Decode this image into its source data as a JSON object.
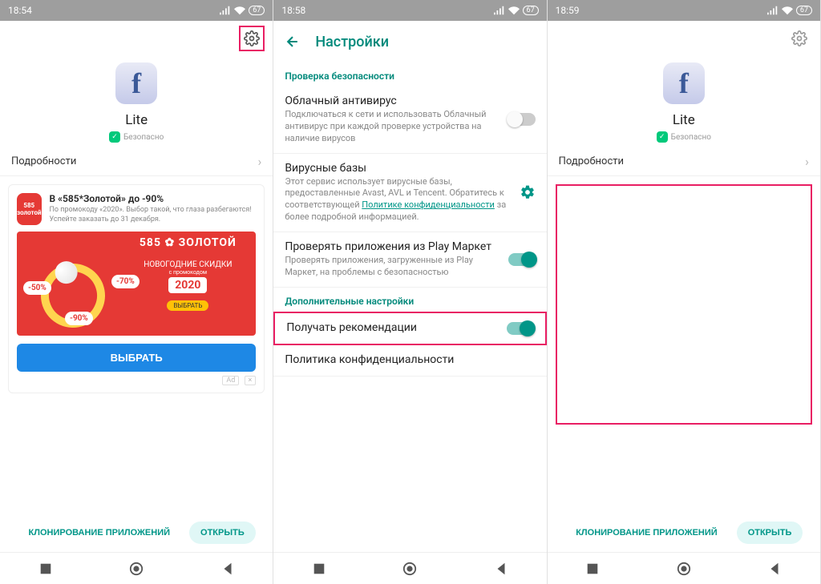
{
  "screen1": {
    "time": "18:54",
    "battery": "67",
    "app_name": "Lite",
    "safety_label": "Безопасно",
    "details_label": "Подробности",
    "ad": {
      "logo_top": "585",
      "logo_bottom": "золотой",
      "title": "В «585*Золотой» до -90%",
      "subtitle": "По промокоду «2020». Выбор такой, что глаза разбегаются! Успейте заказать до 31 декабря.",
      "banner_brand": "585 ✿ ЗОЛОТОЙ",
      "banner_headline": "НОВОГОДНИЕ СКИДКИ",
      "banner_promo_label": "с промокодом",
      "banner_promo_code": "2020",
      "discount1": "-50%",
      "discount2": "-70%",
      "discount3": "-90%",
      "banner_cta": "ВЫБРАТЬ",
      "select_button": "ВЫБРАТЬ",
      "ad_tag": "Ad",
      "ad_close": "×"
    },
    "bottom_clone": "КЛОНИРОВАНИЕ ПРИЛОЖЕНИЙ",
    "bottom_open": "ОТКРЫТЬ"
  },
  "screen2": {
    "time": "18:58",
    "battery": "67",
    "title": "Настройки",
    "section_security": "Проверка безопасности",
    "antivirus_title": "Облачный антивирус",
    "antivirus_desc": "Подключаться к сети и использовать Облачный антивирус при каждой проверке устройства на наличие вирусов",
    "virusdb_title": "Вирусные базы",
    "virusdb_desc_a": "Этот сервис использует вирусные базы, предоставленные Avast, AVL и Tencent. Обратитесь к соответствующей ",
    "virusdb_link": "Политике конфиденциальности",
    "virusdb_desc_b": " за более подробной информацией.",
    "playmarket_title": "Проверять приложения из Play Маркет",
    "playmarket_desc": "Проверять приложения, загруженные из Play Маркет, на проблемы с безопасностью",
    "section_additional": "Дополнительные настройки",
    "recommendations_title": "Получать рекомендации",
    "privacy_title": "Политика конфиденциальности"
  },
  "screen3": {
    "time": "18:59",
    "battery": "67",
    "app_name": "Lite",
    "safety_label": "Безопасно",
    "details_label": "Подробности",
    "bottom_clone": "КЛОНИРОВАНИЕ ПРИЛОЖЕНИЙ",
    "bottom_open": "ОТКРЫТЬ"
  }
}
